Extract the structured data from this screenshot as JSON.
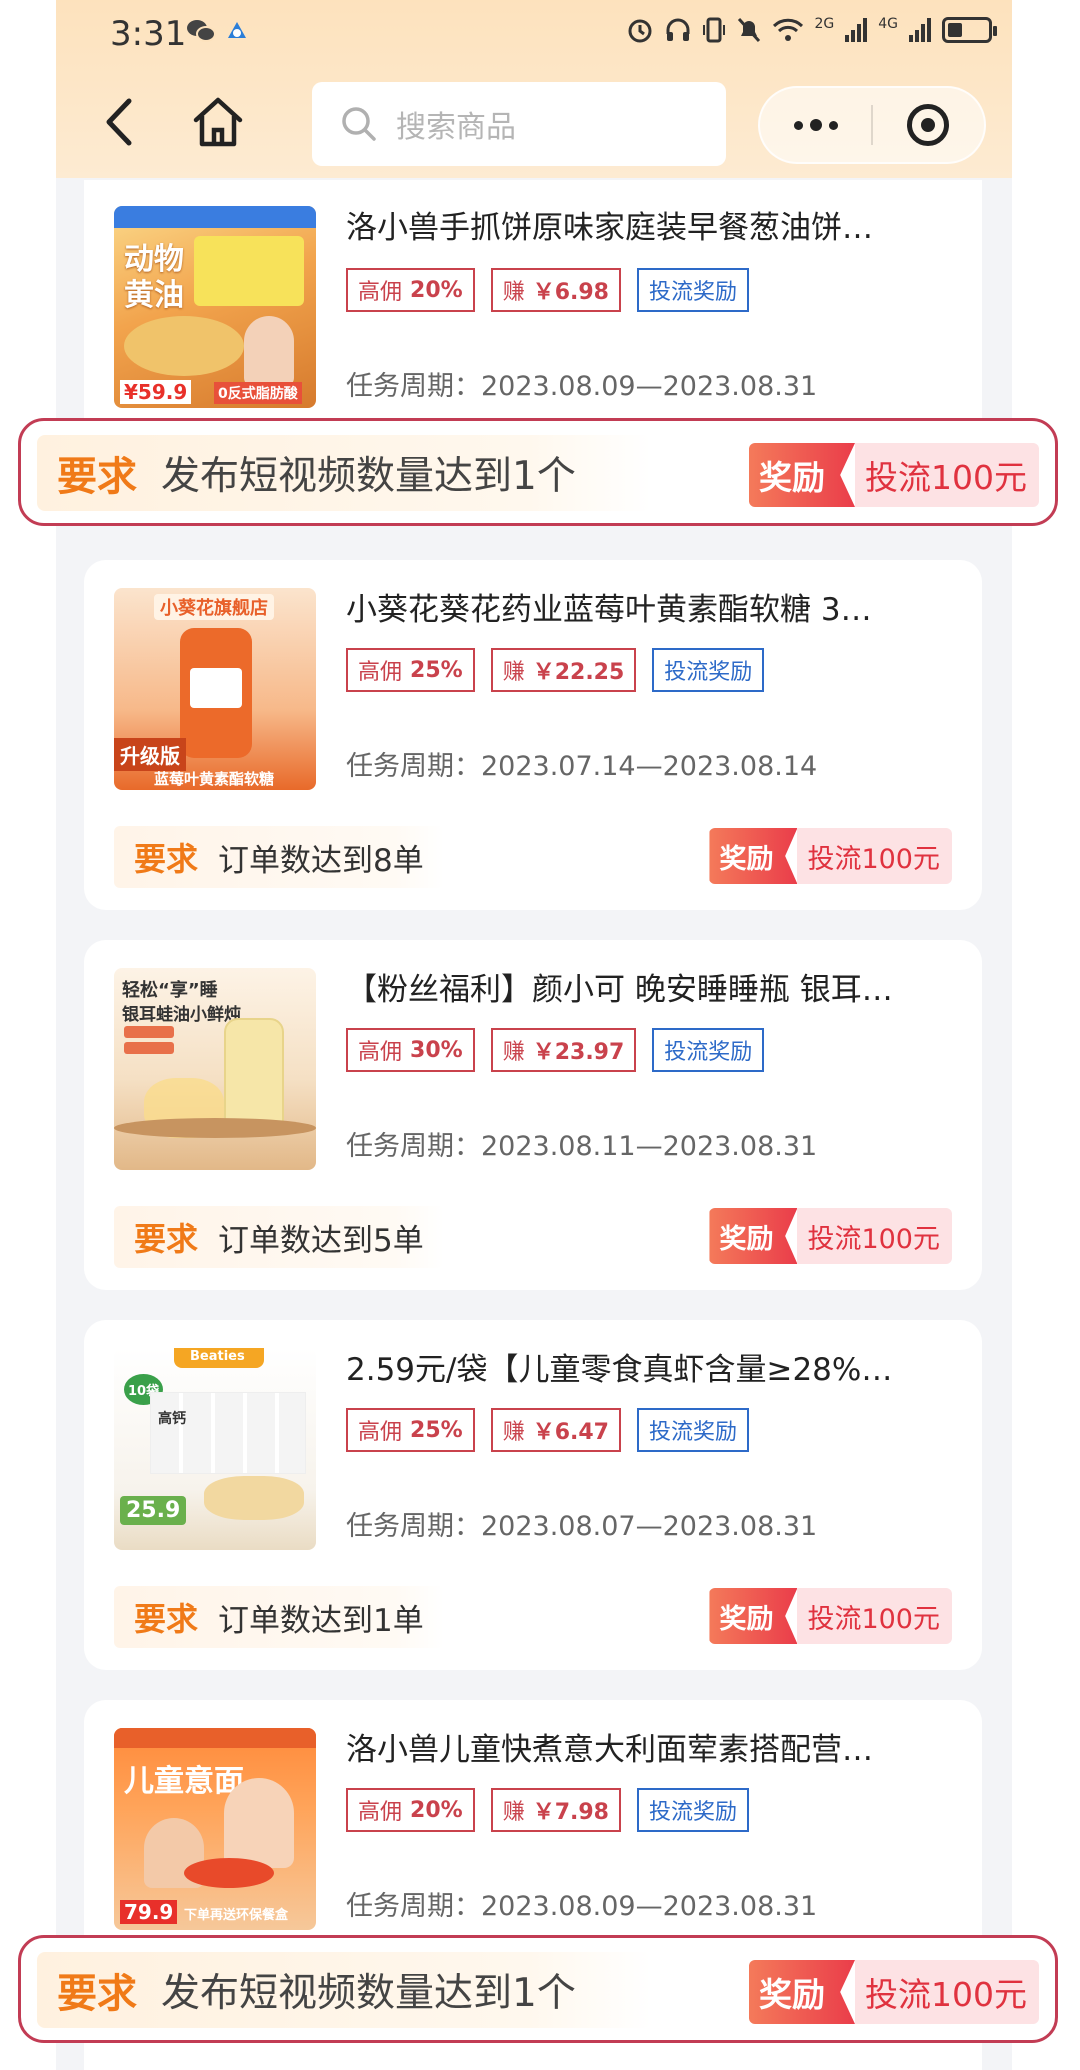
{
  "status_bar": {
    "time": "3:31",
    "network_1": "2G",
    "network_2": "4G"
  },
  "nav": {
    "search_placeholder": "搜索商品"
  },
  "products": [
    {
      "title": "洛小兽手抓饼原味家庭装早餐葱油饼…",
      "commission_label": "高佣",
      "commission_value": "20%",
      "earn_label": "赚",
      "earn_value": "￥6.98",
      "flow_tag": "投流奖励",
      "period": "任务周期：2023.08.09—2023.08.31",
      "requirement_label": "要求",
      "requirement": "发布短视频数量达到1个",
      "reward_label": "奖励",
      "reward_value": "投流100元",
      "thumb_text": [
        "动物",
        "黄油",
        "¥59.9",
        "0反式脂肪酸"
      ]
    },
    {
      "title": "小葵花葵花药业蓝莓叶黄素酯软糖 3…",
      "commission_label": "高佣",
      "commission_value": "25%",
      "earn_label": "赚",
      "earn_value": "￥22.25",
      "flow_tag": "投流奖励",
      "period": "任务周期：2023.07.14—2023.08.14",
      "requirement_label": "要求",
      "requirement": "订单数达到8单",
      "reward_label": "奖励",
      "reward_value": "投流100元",
      "thumb_text": [
        "小葵花旗舰店",
        "升级版",
        "蓝莓叶黄素酯软糖"
      ]
    },
    {
      "title": "【粉丝福利】颜小可 晚安睡睡瓶 银耳…",
      "commission_label": "高佣",
      "commission_value": "30%",
      "earn_label": "赚",
      "earn_value": "￥23.97",
      "flow_tag": "投流奖励",
      "period": "任务周期：2023.08.11—2023.08.31",
      "requirement_label": "要求",
      "requirement": "订单数达到5单",
      "reward_label": "奖励",
      "reward_value": "投流100元",
      "thumb_text": [
        "轻松“享”睡",
        "银耳蛙油小鲜炖"
      ]
    },
    {
      "title": "2.59元/袋【儿童零食真虾含量≥28%…",
      "commission_label": "高佣",
      "commission_value": "25%",
      "earn_label": "赚",
      "earn_value": "￥6.47",
      "flow_tag": "投流奖励",
      "period": "任务周期：2023.08.07—2023.08.31",
      "requirement_label": "要求",
      "requirement": "订单数达到1单",
      "reward_label": "奖励",
      "reward_value": "投流100元",
      "thumb_text": [
        "Beaties",
        "10袋",
        "高钙",
        "25.9"
      ]
    },
    {
      "title": "洛小兽儿童快煮意大利面荤素搭配营…",
      "commission_label": "高佣",
      "commission_value": "20%",
      "earn_label": "赚",
      "earn_value": "￥7.98",
      "flow_tag": "投流奖励",
      "period": "任务周期：2023.08.09—2023.08.31",
      "requirement_label": "要求",
      "requirement": "发布短视频数量达到1个",
      "reward_label": "奖励",
      "reward_value": "投流100元",
      "thumb_text": [
        "儿童意面",
        "79.9",
        "下单再送环保餐盒"
      ]
    }
  ],
  "colors": {
    "accent_orange": "#f07a18",
    "commission_red": "#c9424c",
    "flow_blue": "#2d6ac8",
    "highlight_border": "#c23c54"
  }
}
